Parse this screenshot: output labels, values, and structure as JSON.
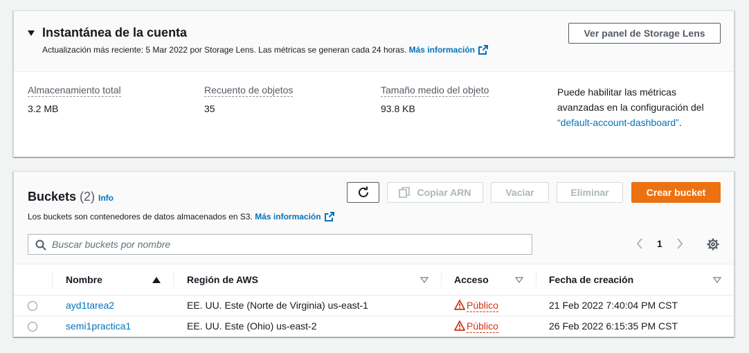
{
  "snapshot": {
    "title": "Instantánea de la cuenta",
    "description": "Actualización más reciente: 5 Mar 2022 por Storage Lens. Las métricas se generan cada 24 horas.",
    "more_info": "Más información",
    "view_button": "Ver panel de Storage Lens",
    "metrics": [
      {
        "label": "Almacenamiento total",
        "value": "3.2 MB"
      },
      {
        "label": "Recuento de objetos",
        "value": "35"
      },
      {
        "label": "Tamaño medio del objeto",
        "value": "93.8 KB"
      }
    ],
    "advanced_text": "Puede habilitar las métricas avanzadas en la configuración del",
    "advanced_link": "“default-account-dashboard”",
    "advanced_end": "."
  },
  "buckets": {
    "title": "Buckets",
    "count": "(2)",
    "info": "Info",
    "description": "Los buckets son contenedores de datos almacenados en S3.",
    "more_info": "Más información",
    "buttons": {
      "copy_arn": "Copiar ARN",
      "empty": "Vaciar",
      "delete": "Eliminar",
      "create": "Crear bucket"
    },
    "search_placeholder": "Buscar buckets por nombre",
    "page": "1",
    "columns": [
      "Nombre",
      "Región de AWS",
      "Acceso",
      "Fecha de creación"
    ],
    "rows": [
      {
        "name": "ayd1tarea2",
        "region": "EE. UU. Este (Norte de Virginia) us-east-1",
        "access": "Público",
        "created": "21 Feb 2022 7:40:04 PM CST"
      },
      {
        "name": "semi1practica1",
        "region": "EE. UU. Este (Ohio) us-east-2",
        "access": "Público",
        "created": "26 Feb 2022 6:15:35 PM CST"
      }
    ]
  },
  "colors": {
    "accent": "#0073bb",
    "primary_button": "#ec7211",
    "warning": "#d13212"
  },
  "icons": [
    "caret-down-icon",
    "external-link-icon",
    "refresh-icon",
    "copy-icon",
    "search-icon",
    "chevron-left-icon",
    "chevron-right-icon",
    "gear-icon",
    "sort-ascending-icon",
    "sort-icon",
    "warning-icon"
  ]
}
